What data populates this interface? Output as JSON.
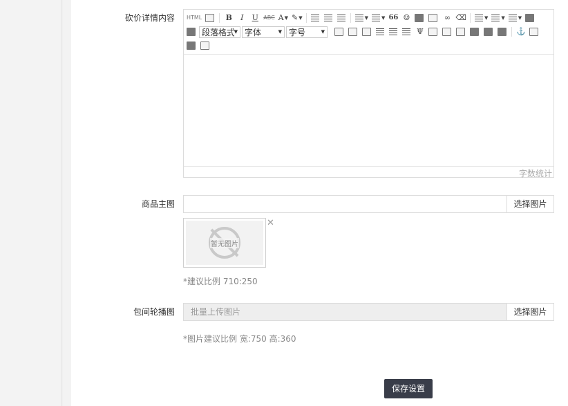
{
  "form": {
    "detail": {
      "label": "砍价详情内容",
      "toolbar": {
        "html_btn": "HTML",
        "bold": "B",
        "italic": "I",
        "underline": "U",
        "strike": "ABC",
        "font_color": "A",
        "quote": "66",
        "paragraph_select": "段落格式",
        "font_select": "字体",
        "size_select": "字号"
      },
      "word_count": "字数统计"
    },
    "main_image": {
      "label": "商品主图",
      "input_value": "",
      "pick_button": "选择图片",
      "placeholder_image_text": "暂无图片",
      "hint": "*建议比例 710:250"
    },
    "carousel": {
      "label": "包间轮播图",
      "placeholder": "批量上传图片",
      "pick_button": "选择图片",
      "hint": "*图片建议比例 宽:750 高:360"
    },
    "save_button": "保存设置"
  },
  "colors": {
    "save_button_bg": "#393d49",
    "hint_text": "#888888",
    "border": "#dcdcdc"
  }
}
